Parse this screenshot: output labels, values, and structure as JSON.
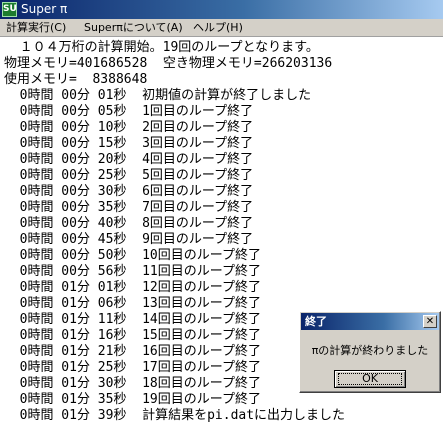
{
  "window": {
    "title": "Super π",
    "app_icon_text": "SU"
  },
  "menu": [
    {
      "label": "計算実行(C)"
    },
    {
      "label": "Superπについて(A)"
    },
    {
      "label": "ヘルプ(H)"
    }
  ],
  "console": {
    "lines": [
      "  １０４万桁の計算開始。19回のループとなります。",
      "物理メモリ=401686528  空き物理メモリ=266203136",
      "使用メモリ=  8388648",
      "  0時間 00分 01秒  初期値の計算が終了しました",
      "  0時間 00分 05秒  1回目のループ終了",
      "  0時間 00分 10秒  2回目のループ終了",
      "  0時間 00分 15秒  3回目のループ終了",
      "  0時間 00分 20秒  4回目のループ終了",
      "  0時間 00分 25秒  5回目のループ終了",
      "  0時間 00分 30秒  6回目のループ終了",
      "  0時間 00分 35秒  7回目のループ終了",
      "  0時間 00分 40秒  8回目のループ終了",
      "  0時間 00分 45秒  9回目のループ終了",
      "  0時間 00分 50秒  10回目のループ終了",
      "  0時間 00分 56秒  11回目のループ終了",
      "  0時間 01分 01秒  12回目のループ終了",
      "  0時間 01分 06秒  13回目のループ終了",
      "  0時間 01分 11秒  14回目のループ終了",
      "  0時間 01分 16秒  15回目のループ終了",
      "  0時間 01分 21秒  16回目のループ終了",
      "  0時間 01分 25秒  17回目のループ終了",
      "  0時間 01分 30秒  18回目のループ終了",
      "  0時間 01分 35秒  19回目のループ終了",
      "  0時間 01分 39秒  計算結果をpi.datに出力しました"
    ]
  },
  "dialog": {
    "title": "終了",
    "message": "πの計算が終わりました",
    "ok_label": "OK",
    "close_glyph": "✕"
  }
}
